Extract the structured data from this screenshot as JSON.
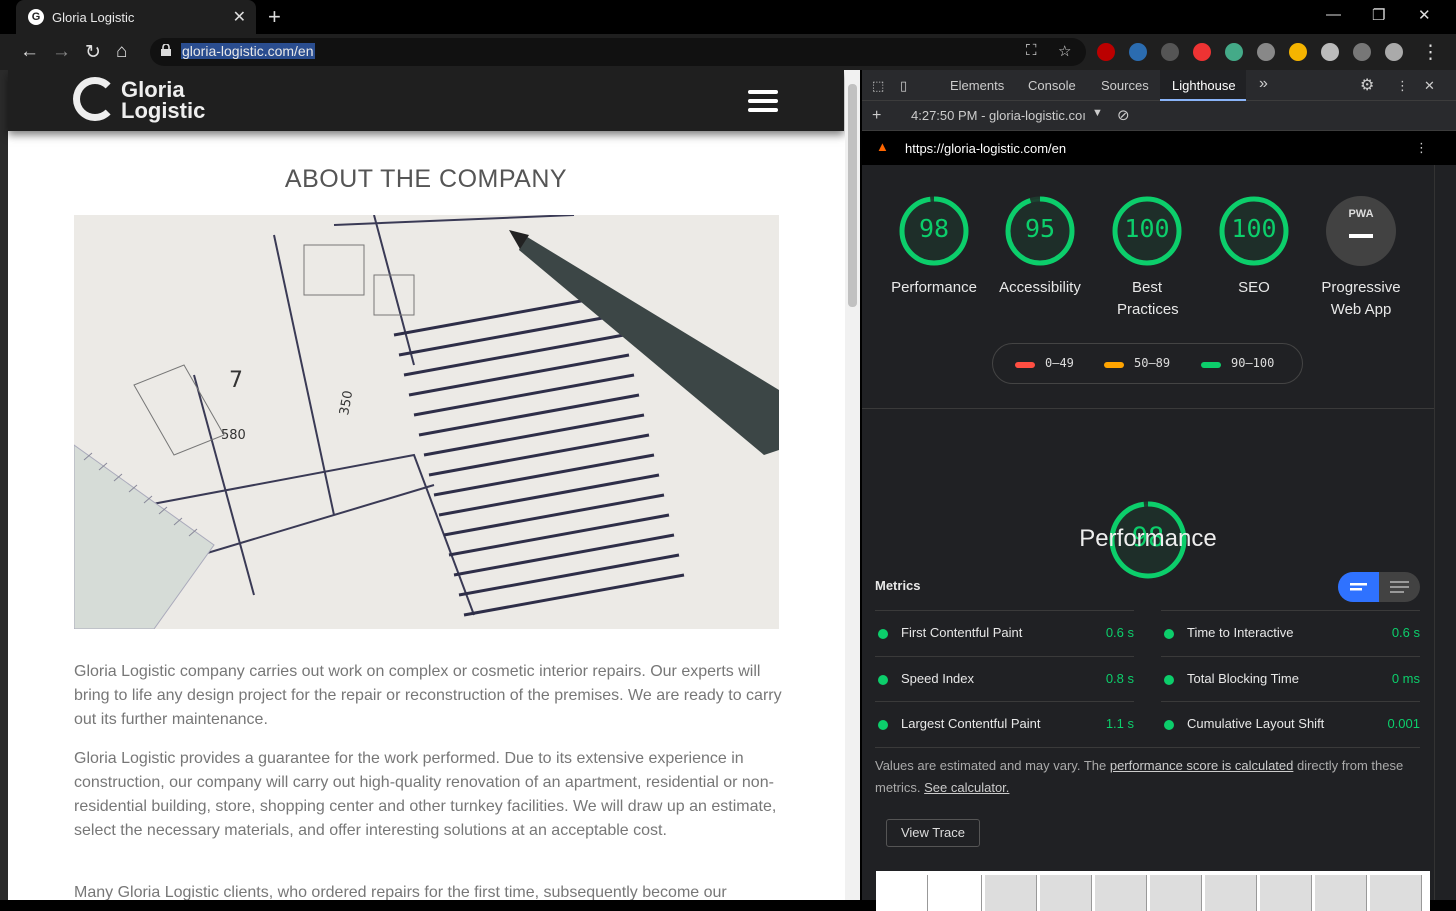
{
  "browser": {
    "tab_title": "Gloria Logistic",
    "tab_favicon": "G",
    "new_tab_label": "+",
    "url": "gloria-logistic.com/en"
  },
  "page": {
    "logo_line1": "Gloria",
    "logo_line2": "Logistic",
    "heading": "ABOUT THE COMPANY",
    "paragraphs": [
      "Gloria Logistic company carries out work on complex or cosmetic interior repairs. Our experts will bring to life any design project for the repair or reconstruction of the premises. We are ready to carry out its further maintenance.",
      "Gloria Logistic provides a guarantee for the work performed. Due to its extensive experience in construction, our company will carry out high-quality renovation of an apartment, residential or non-residential building, store, shopping center and other turnkey facilities. We will draw up an estimate, select the necessary materials, and offer interesting solutions at an acceptable cost.",
      "Many Gloria Logistic clients, who ordered repairs for the first time, subsequently become our"
    ]
  },
  "devtools": {
    "tabs": [
      "Elements",
      "Console",
      "Sources",
      "Lighthouse"
    ],
    "more_tabs": "»",
    "report_time": "4:27:50 PM - gloria-logistic.coı",
    "audited_url": "https://gloria-logistic.com/en",
    "scores": [
      {
        "value": "98",
        "label": "Performance",
        "score": 0.98
      },
      {
        "value": "95",
        "label": "Accessibility",
        "score": 0.95
      },
      {
        "value": "100",
        "label": "Best Practices",
        "score": 1.0
      },
      {
        "value": "100",
        "label": "SEO",
        "score": 1.0
      }
    ],
    "pwa": {
      "badge": "PWA",
      "label": "Progressive Web App"
    },
    "legend": [
      {
        "range": "0–49",
        "color": "#ff4e42"
      },
      {
        "range": "50–89",
        "color": "#ffa400"
      },
      {
        "range": "90–100",
        "color": "#0cce6b"
      }
    ],
    "performance": {
      "score_value": "98",
      "score": 0.98,
      "title": "Performance",
      "metrics_title": "Metrics",
      "metrics": [
        {
          "name": "First Contentful Paint",
          "value": "0.6 s"
        },
        {
          "name": "Time to Interactive",
          "value": "0.6 s"
        },
        {
          "name": "Speed Index",
          "value": "0.8 s"
        },
        {
          "name": "Total Blocking Time",
          "value": "0 ms"
        },
        {
          "name": "Largest Contentful Paint",
          "value": "1.1 s"
        },
        {
          "name": "Cumulative Layout Shift",
          "value": "0.001"
        }
      ],
      "note_before": "Values are estimated and may vary. The ",
      "note_link1": "performance score is calculated",
      "note_middle": " directly from these metrics. ",
      "note_link2": "See calculator.",
      "view_trace": "View Trace"
    }
  },
  "colors": {
    "pass": "#0cce6b",
    "accent": "#2f72ff",
    "selection": "#2a4d8f"
  }
}
